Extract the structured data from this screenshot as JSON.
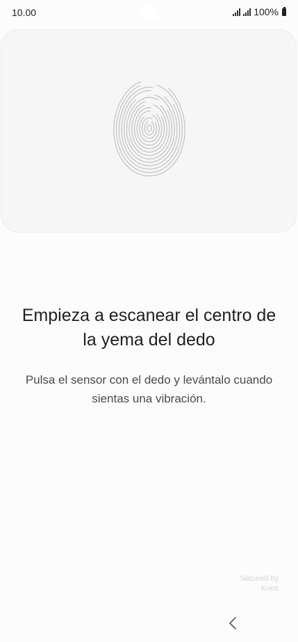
{
  "status_bar": {
    "time": "10.00",
    "battery_text": "100%",
    "icons": [
      "signal-sim1-icon",
      "signal-sim2-icon",
      "battery-icon"
    ]
  },
  "sensor_area": {
    "icon": "fingerprint-icon"
  },
  "content": {
    "title": "Empieza a escanear el centro de la yema del dedo",
    "description": "Pulsa el sensor con el dedo y levántalo cuando sientas una vibración."
  },
  "footer": {
    "knox_line1": "Secured by",
    "knox_line2": "Knox"
  },
  "nav_bar": {
    "back_icon": "back-chevron-icon"
  },
  "colors": {
    "background": "#fcfcfc",
    "card": "#f6f6f6",
    "fingerprint": "#bdbdbd",
    "text": "#202020"
  }
}
